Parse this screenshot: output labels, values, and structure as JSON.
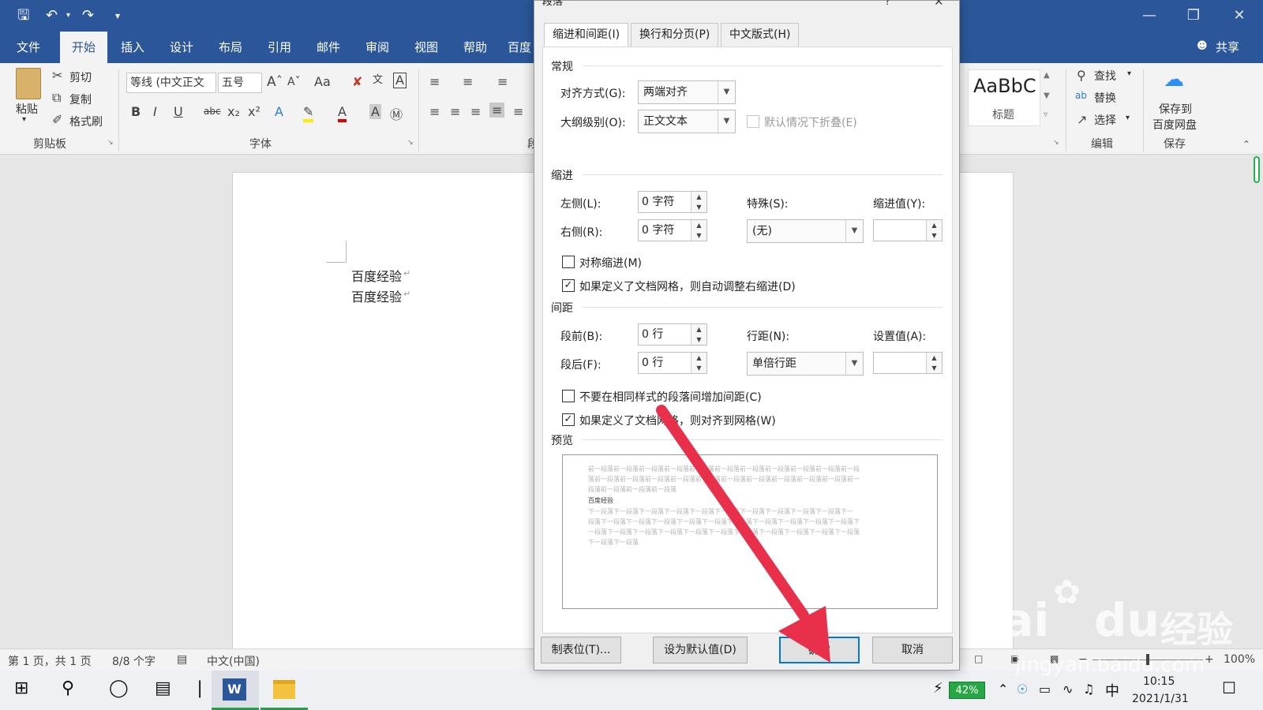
{
  "ribbon_tabs": [
    "文件",
    "开始",
    "插入",
    "设计",
    "布局",
    "引用",
    "邮件",
    "审阅",
    "视图",
    "帮助",
    "百度"
  ],
  "titlebar": {
    "share_label": "共享",
    "dialog_title": "段落"
  },
  "clipboard": {
    "paste": "粘贴",
    "cut": "剪切",
    "copy": "复制",
    "format_painter": "格式刷",
    "group": "剪贴板"
  },
  "font": {
    "family": "等线 (中文正文",
    "size": "五号",
    "group": "字体",
    "change_case": "Aa"
  },
  "styles": {
    "sample": "AaBbC",
    "style_name": "标题"
  },
  "editing": {
    "find": "查找",
    "replace": "替换",
    "select": "选择",
    "group": "编辑"
  },
  "save_group": {
    "save_to": "保存到",
    "baidu_disk": "百度网盘",
    "group": "保存"
  },
  "partial_group_label": "段",
  "document": {
    "lines": [
      "百度经验",
      "百度经验"
    ]
  },
  "statusbar": {
    "page": "第 1 页，共 1 页",
    "words": "8/8 个字",
    "lang": "中文(中国)",
    "zoom": "100%"
  },
  "taskbar": {
    "battery": "42%",
    "ime": "中",
    "time": "10:15",
    "date": "2021/1/31"
  },
  "dialog": {
    "tabs": [
      "缩进和间距(I)",
      "换行和分页(P)",
      "中文版式(H)"
    ],
    "general": {
      "title": "常规",
      "alignment_label": "对齐方式(G):",
      "alignment_value": "两端对齐",
      "outline_label": "大纲级别(O):",
      "outline_value": "正文文本",
      "collapsed_label": "默认情况下折叠(E)"
    },
    "indent": {
      "title": "缩进",
      "left_label": "左侧(L):",
      "left_value": "0 字符",
      "right_label": "右侧(R):",
      "right_value": "0 字符",
      "special_label": "特殊(S):",
      "special_value": "(无)",
      "by_label": "缩进值(Y):",
      "mirror_label": "对称缩进(M)",
      "auto_right_label": "如果定义了文档网格，则自动调整右缩进(D)"
    },
    "spacing": {
      "title": "间距",
      "before_label": "段前(B):",
      "before_value": "0 行",
      "after_label": "段后(F):",
      "after_value": "0 行",
      "line_label": "行距(N):",
      "line_value": "单倍行距",
      "at_label": "设置值(A):",
      "no_space_label": "不要在相同样式的段落间增加间距(C)",
      "snap_grid_label": "如果定义了文档网格，则对齐到网格(W)"
    },
    "preview": {
      "title": "预览",
      "prev_lines": [
        "前一段落前一段落前一段落前一段落前一段落前一段落前一段落前一段落前一段落前一段落前一段",
        "落前一段落前一段落前一段落前一段落前一段落前一段落前一段落前一段落前一段落前一段落前一",
        "段落前一段落前一段落前一段落"
      ],
      "sample": "百度经验",
      "next_lines": [
        "下一段落下一段落下一段落下一段落下一段落下一段落下一段落下一段落下一段落下一段落下一",
        "段落下一段落下一段落下一段落下一段落下一段落下一段落下一段落下一段落下一段落下一段落下",
        "一段落下一段落下一段落下一段落下一段落下一段落下一段落下一段落下一段落下一段落下一段落",
        "下一段落下一段落"
      ]
    },
    "buttons": {
      "tabs": "制表位(T)...",
      "default": "设为默认值(D)",
      "ok": "确定",
      "cancel": "取消"
    }
  },
  "watermark": {
    "logo": "Bai",
    "logo2": "du",
    "cn": "经验",
    "url": "jingyan.baidu.com"
  },
  "colors": {
    "word_blue": "#2b579a",
    "arrow_red": "#e8304a",
    "focus_blue": "#0078d7"
  }
}
